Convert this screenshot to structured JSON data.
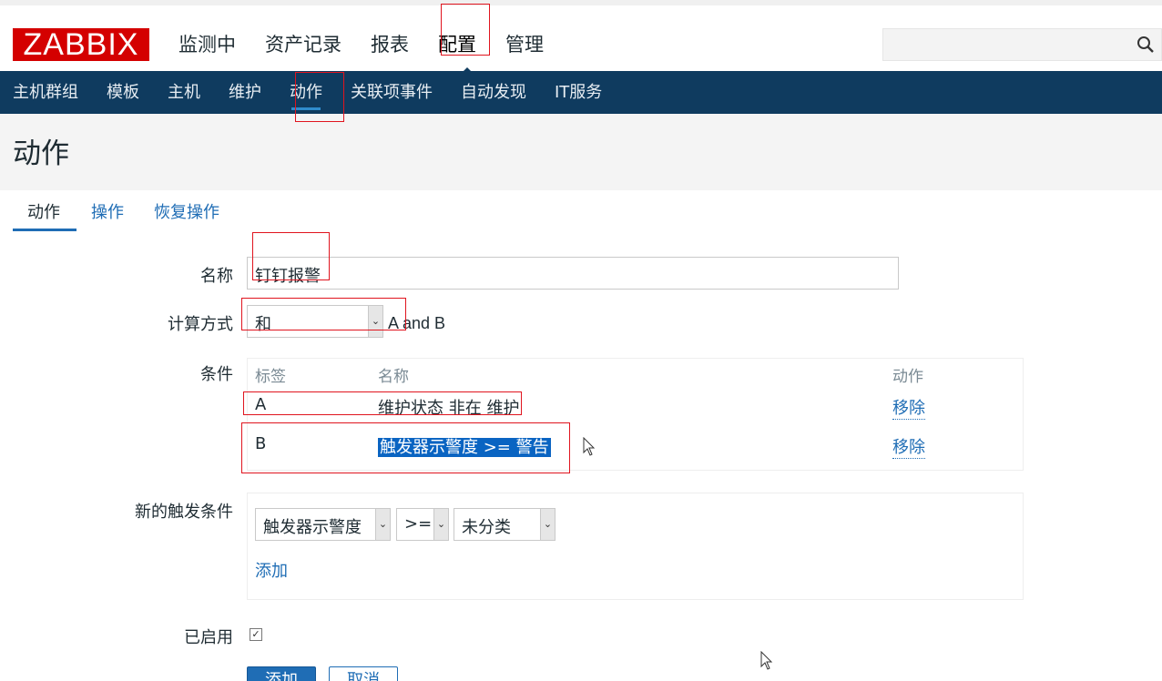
{
  "app": {
    "logo_text": "ZABBIX"
  },
  "main_nav": {
    "items": [
      {
        "label": "监测中"
      },
      {
        "label": "资产记录"
      },
      {
        "label": "报表"
      },
      {
        "label": "配置"
      },
      {
        "label": "管理"
      }
    ],
    "active_index": 3
  },
  "search": {
    "value": "",
    "icon": "search-icon"
  },
  "sub_nav": {
    "items": [
      {
        "label": "主机群组"
      },
      {
        "label": "模板"
      },
      {
        "label": "主机"
      },
      {
        "label": "维护"
      },
      {
        "label": "动作"
      },
      {
        "label": "关联项事件"
      },
      {
        "label": "自动发现"
      },
      {
        "label": "IT服务"
      }
    ],
    "active_index": 4
  },
  "page": {
    "title": "动作"
  },
  "tabs": [
    {
      "label": "动作"
    },
    {
      "label": "操作"
    },
    {
      "label": "恢复操作"
    }
  ],
  "form": {
    "name_label": "名称",
    "name_value": "钉钉报警",
    "calc_label": "计算方式",
    "calc_value": "和",
    "calc_formula": "A and B",
    "conditions_label": "条件",
    "conditions_table": {
      "headers": {
        "label": "标签",
        "name": "名称",
        "action": "动作"
      },
      "rows": [
        {
          "label": "A",
          "name": "维护状态 非在 维护",
          "action": "移除"
        },
        {
          "label": "B",
          "name": "触发器示警度 >= 警告",
          "action": "移除"
        }
      ]
    },
    "new_condition_label": "新的触发条件",
    "new_condition": {
      "type": "触发器示警度",
      "operator": ">=",
      "value": "未分类",
      "add_link": "添加"
    },
    "enabled_label": "已启用",
    "enabled": true,
    "add_button": "添加",
    "cancel_button": "取消"
  },
  "colors": {
    "logo_red": "#d40000",
    "nav_dark": "#0f3b5f",
    "link_blue": "#1f6db5",
    "annotation_red": "#e0141e"
  }
}
